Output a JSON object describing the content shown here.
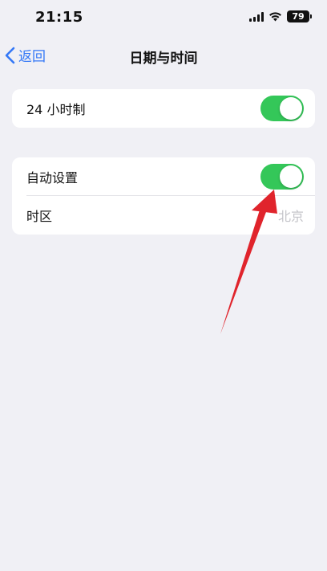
{
  "status_bar": {
    "time": "21:15",
    "battery_level": "79"
  },
  "nav": {
    "back_label": "返回",
    "title": "日期与时间"
  },
  "settings": {
    "hour24": {
      "label": "24 小时制",
      "enabled": true
    },
    "auto_set": {
      "label": "自动设置",
      "enabled": true
    },
    "timezone": {
      "label": "时区",
      "value": "北京"
    }
  },
  "colors": {
    "accent": "#3478f6",
    "toggle_on": "#34c759",
    "annotation_arrow": "#e0242c",
    "background": "#f0f0f5"
  },
  "icons": {
    "back": "chevron-left-icon",
    "signal": "cellular-signal-icon",
    "wifi": "wifi-icon",
    "battery": "battery-icon"
  }
}
